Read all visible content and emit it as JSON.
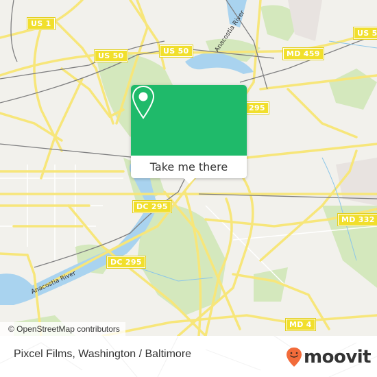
{
  "map": {
    "shields": [
      {
        "label": "US 1",
        "id": "us-1"
      },
      {
        "label": "US 50",
        "id": "us-50-west"
      },
      {
        "label": "US 50",
        "id": "us-50-east"
      },
      {
        "label": "MD 459",
        "id": "md-459"
      },
      {
        "label": "295",
        "id": "dc-295-north"
      },
      {
        "label": "DC 295",
        "id": "dc-295-center"
      },
      {
        "label": "DC 295",
        "id": "dc-295-south"
      },
      {
        "label": "MD 332",
        "id": "md-332"
      },
      {
        "label": "MD 4",
        "id": "md-4"
      }
    ],
    "water_labels": [
      {
        "label": "Anacostia River",
        "id": "anacostia-river-south"
      },
      {
        "label": "Anacostia River",
        "id": "anacostia-river-north"
      }
    ],
    "attribution": "© OpenStreetMap contributors",
    "colors": {
      "land": "#f2f1ec",
      "park": "#cfe6b5",
      "water": "#a9d3ef",
      "road": "#f7e67a",
      "shield": "#f1df2c"
    }
  },
  "popup": {
    "icon": "map-pin-icon",
    "button_label": "Take me there",
    "accent": "#1fba6a"
  },
  "footer": {
    "place_title": "Pixcel Films, Washington / Baltimore",
    "brand": "moovit",
    "brand_color": "#f26b3a"
  }
}
